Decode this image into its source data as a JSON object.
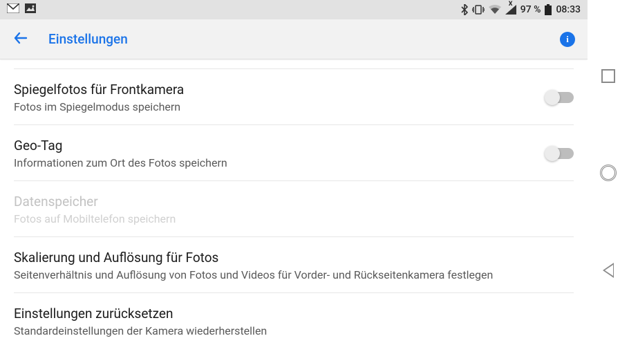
{
  "status": {
    "battery_percent": "97 %",
    "time": "08:33"
  },
  "header": {
    "title": "Einstellungen"
  },
  "items": [
    {
      "title": "Spiegelfotos für Frontkamera",
      "sub": "Fotos im Spiegelmodus speichern",
      "toggle": true,
      "on": false,
      "disabled": false
    },
    {
      "title": "Geo-Tag",
      "sub": "Informationen zum Ort des Fotos speichern",
      "toggle": true,
      "on": false,
      "disabled": false
    },
    {
      "title": "Datenspeicher",
      "sub": "Fotos auf Mobiltelefon speichern",
      "toggle": false,
      "disabled": true
    },
    {
      "title": "Skalierung und Auflösung für Fotos",
      "sub": "Seitenverhältnis und Auflösung von Fotos und Videos für Vorder- und Rückseitenkamera festlegen",
      "toggle": false,
      "disabled": false
    },
    {
      "title": "Einstellungen zurücksetzen",
      "sub": "Standardeinstellungen der Kamera wiederherstellen",
      "toggle": false,
      "disabled": false
    }
  ]
}
